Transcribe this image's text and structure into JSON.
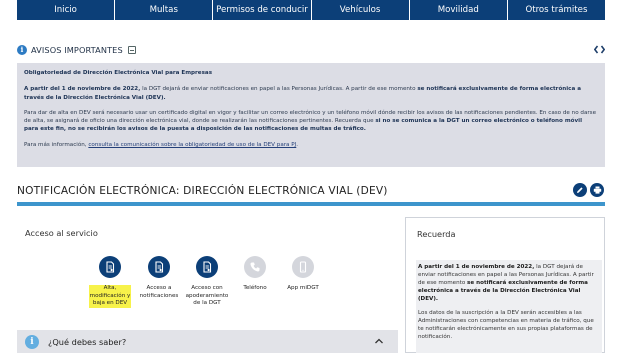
{
  "nav": {
    "items": [
      "Inicio",
      "Multas",
      "Permisos de conducir",
      "Vehículos",
      "Movilidad",
      "Otros trámites"
    ]
  },
  "avisos": {
    "title": "AVISOS IMPORTANTES",
    "notice_title": "Obligatoriedad de Dirección Electrónica Vial para Empresas",
    "p1_a": "A partir del 1 de noviembre de 2022,",
    "p1_b": " la DGT dejará de enviar notificaciones en papel a las Personas Jurídicas. A partir de ese momento ",
    "p1_c": "se notificará exclusivamente de forma electrónica a través de la Dirección Electrónica Vial (DEV).",
    "p2_a": "Para dar de alta en DEV será necesario usar un certificado digital en vigor y facilitar un correo electrónico y un teléfono móvil dónde recibir los avisos de las notificaciones pendientes. En caso de no darse de alta, se asignará de oficio una dirección electrónica vial, donde se realizarán las notificaciones pertinentes. Recuerda que ",
    "p2_b": "si no se comunica a la DGT un correo electrónico o teléfono móvil para este fin, no se recibirán los avisos de la puesta a disposición de las notificaciones de multas de tráfico.",
    "p3_a": "Para más información, ",
    "p3_link": "consulta la comunicación sobre la obligatoriedad de uso de la DEV para PJ",
    "p3_b": "."
  },
  "section": {
    "title": "NOTIFICACIÓN ELECTRÓNICA: DIRECCIÓN ELECTRÓNICA VIAL (DEV)"
  },
  "access": {
    "label": "Acceso al servicio",
    "services": [
      {
        "label": "Alta,\nmodificación y\nbaja en DEV",
        "active": true,
        "highlighted": true,
        "icon": "document-icon"
      },
      {
        "label": "Acceso a\nnotificaciones",
        "active": true,
        "highlighted": false,
        "icon": "document-icon"
      },
      {
        "label": "Acceso con\napoderamiento\nde la DGT",
        "active": true,
        "highlighted": false,
        "icon": "document-icon"
      },
      {
        "label": "Teléfono",
        "active": false,
        "highlighted": false,
        "icon": "phone-icon"
      },
      {
        "label": "App miDGT",
        "active": false,
        "highlighted": false,
        "icon": "mobile-app-icon"
      }
    ]
  },
  "recuerda": {
    "title": "Recuerda",
    "p1_a": "A partir del 1 de noviembre de 2022,",
    "p1_b": " la DGT dejará de enviar notificaciones en papel a las Personas Jurídicas. A partir de ese momento ",
    "p1_c": "se notificará exclusivamente de forma electrónica a través de la Dirección Electrónica Vial (DEV).",
    "p2": "Los datos de la suscripción a la DEV serán accesibles a las Administraciones con competencias en materia de tráfico, que te notificarán electrónicamente en sus propias plataformas de notificación."
  },
  "faq": {
    "label": "¿Qué debes saber?"
  },
  "colors": {
    "brand_navy": "#0c3f78",
    "accent_blue": "#3d95cc",
    "highlight_yellow": "#f7f24a",
    "panel_gray": "#dcdde5"
  }
}
